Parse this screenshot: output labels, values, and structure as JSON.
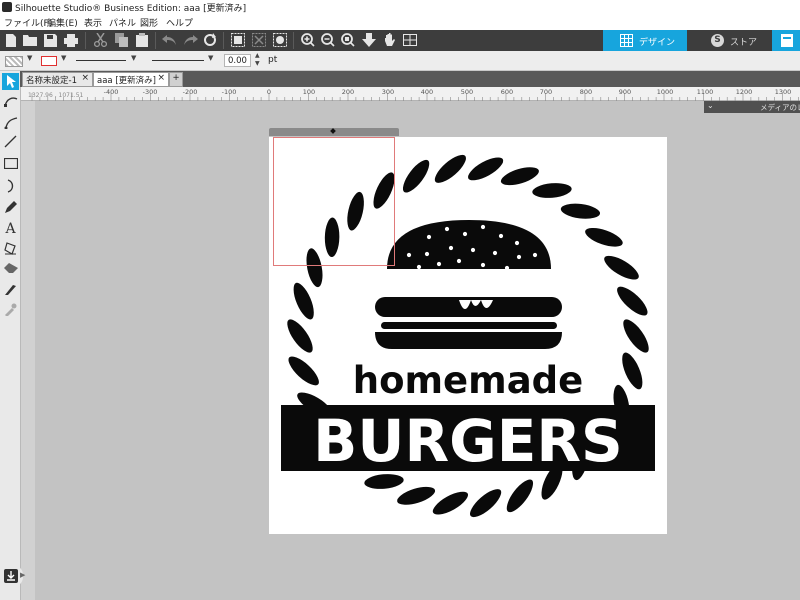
{
  "titlebar": {
    "title": "Silhouette Studio® Business Edition: aaa [更新済み]"
  },
  "menu": {
    "items": [
      "ファイル(F)",
      "編集(E)",
      "表示",
      "パネル",
      "図形",
      "ヘルプ"
    ]
  },
  "toolbar": {
    "icons": [
      "new-file-icon",
      "open-folder-icon",
      "save-icon",
      "print-icon",
      "cut-icon",
      "copy-icon",
      "paste-icon",
      "undo-icon",
      "redo-icon",
      "refresh-icon",
      "group-icon",
      "ungroup-icon",
      "select-all-icon",
      "zoom-in-icon",
      "zoom-out-icon",
      "zoom-fit-icon",
      "pan-down-icon",
      "hand-icon",
      "grid-icon"
    ]
  },
  "nav_tabs": {
    "design": "デザイン",
    "store": "ストア"
  },
  "properties": {
    "line_width": "0.00",
    "line_unit": "pt"
  },
  "doc_tabs": [
    {
      "label": "名称未設定-1",
      "close": "×"
    },
    {
      "label": "aaa [更新済み]",
      "close": "×"
    }
  ],
  "new_tab": "+",
  "ruler": {
    "labels": [
      "-400",
      "-300",
      "-200",
      "-100",
      "0",
      "100",
      "200",
      "300",
      "400",
      "500",
      "600",
      "700",
      "800",
      "900",
      "1000",
      "1100",
      "1200",
      "1300"
    ],
    "cursor_readout": "1327.96 , 1071.51"
  },
  "media_panel": {
    "label": "メディアのレイ"
  },
  "artwork": {
    "top_text": "homemade",
    "main_text": "BURGERS"
  },
  "colors": {
    "accent": "#17a5dd",
    "toolbar": "#3d3d3d",
    "canvas": "#c3c3c3",
    "artwork": "#0a0a0a"
  }
}
